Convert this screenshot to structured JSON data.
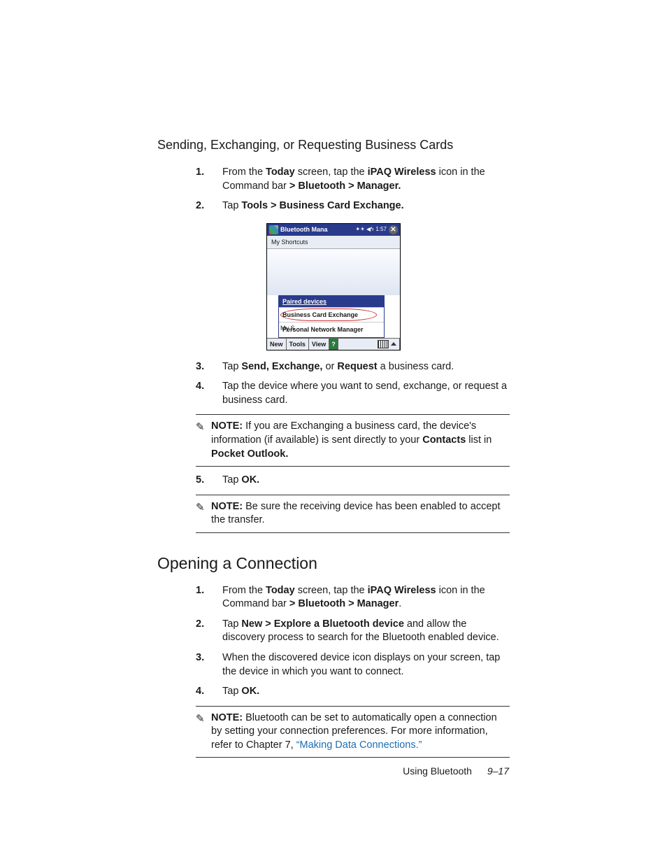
{
  "section_title": "Sending, Exchanging, or Requesting Business Cards",
  "steps1": {
    "s1_a": "From the ",
    "s1_b": "Today",
    "s1_c": " screen, tap the ",
    "s1_d": "iPAQ Wireless",
    "s1_e": " icon in the Command bar ",
    "s1_f": "> Bluetooth > Manager.",
    "s2_a": "Tap ",
    "s2_b": "Tools > Business Card Exchange.",
    "s3_a": "Tap ",
    "s3_b": "Send, Exchange,",
    "s3_c": " or ",
    "s3_d": "Request",
    "s3_e": " a business card.",
    "s4": "Tap the device where you want to send, exchange, or request a business card.",
    "s5_a": "Tap ",
    "s5_b": "OK."
  },
  "note1_a": "NOTE:",
  "note1_b": " If you are Exchanging a business card, the device's information (if available) is sent directly to your ",
  "note1_c": "Contacts",
  "note1_d": " list in ",
  "note1_e": "Pocket Outlook.",
  "note2_a": "NOTE:",
  "note2_b": " Be sure the receiving device has been enabled to accept the transfer.",
  "h2": "Opening a Connection",
  "steps2": {
    "s1_a": "From the ",
    "s1_b": "Today",
    "s1_c": " screen, tap the ",
    "s1_d": "iPAQ Wireless",
    "s1_e": " icon in the Command bar ",
    "s1_f": "> Bluetooth > Manager",
    "s1_g": ".",
    "s2_a": "Tap ",
    "s2_b": "New > Explore a Bluetooth device",
    "s2_c": " and allow the discovery process to search for the Bluetooth enabled device.",
    "s3": "When the discovered device icon displays on your screen, tap the device in which you want to connect.",
    "s4_a": "Tap ",
    "s4_b": "OK."
  },
  "note3_a": "NOTE:",
  "note3_b": " Bluetooth can be set to automatically open a connection by setting your connection preferences. For more information, refer to Chapter 7, ",
  "note3_link": "“Making Data Connections.”",
  "footer_text": "Using Bluetooth",
  "footer_page": "9–17",
  "shot": {
    "title": "Bluetooth Mana",
    "stat": "1:57",
    "tab": "My Shortcuts",
    "menu_header": "Paired devices",
    "menu_item1": "Business Card Exchange",
    "menu_item2": "Personal Network Manager",
    "side": "My S",
    "bb_new": "New",
    "bb_tools": "Tools",
    "bb_view": "View"
  },
  "nums": {
    "n1": "1.",
    "n2": "2.",
    "n3": "3.",
    "n4": "4.",
    "n5": "5."
  }
}
